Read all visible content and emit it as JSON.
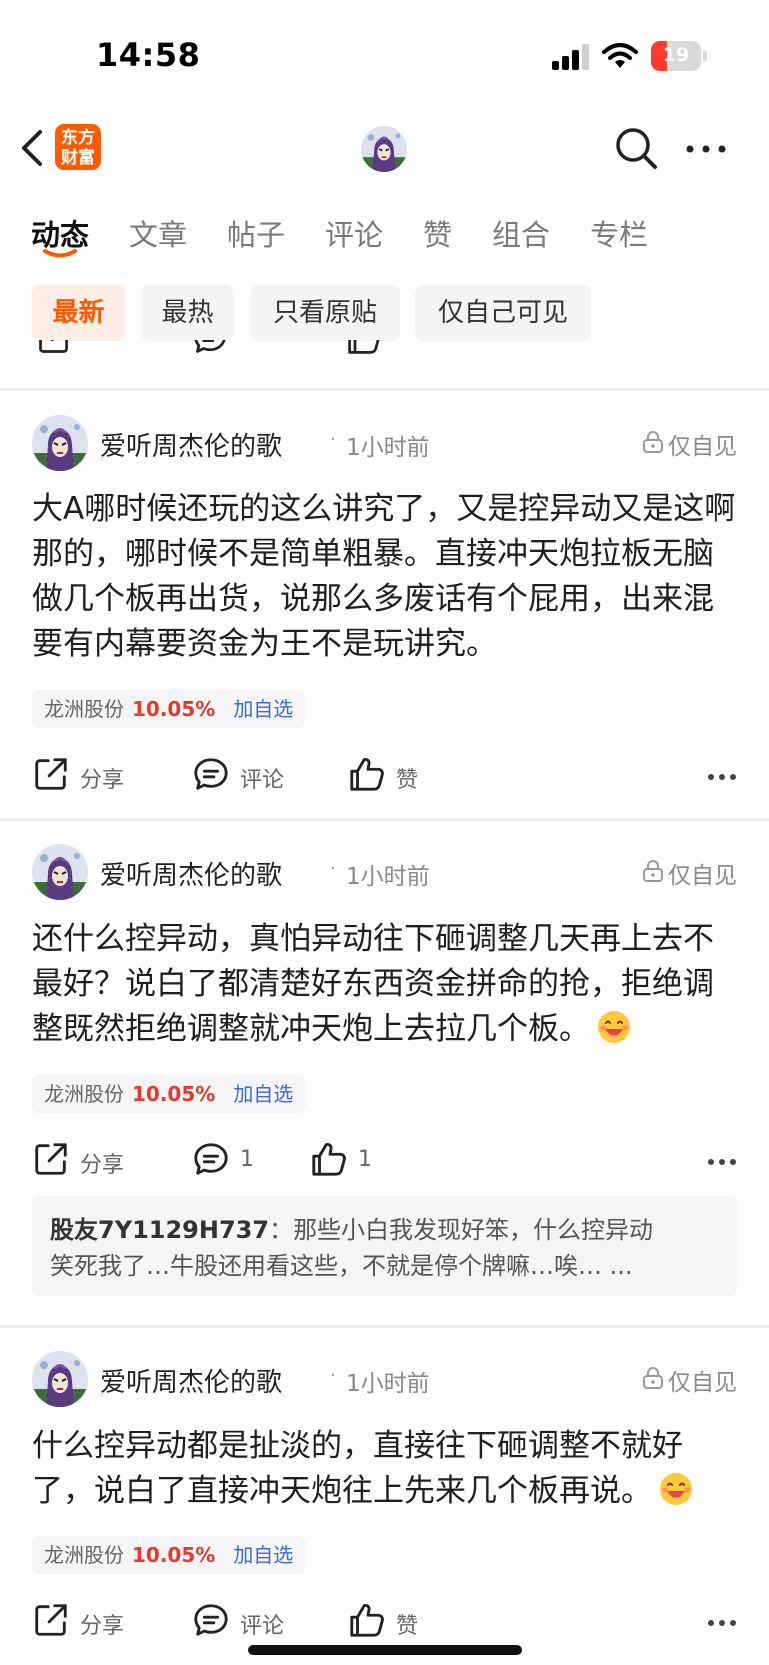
{
  "status_bar": {
    "time": "14:58",
    "battery": "19"
  },
  "header": {
    "logo_text_line1": "东方",
    "logo_text_line2": "财富"
  },
  "tabs": [
    {
      "label": "动态",
      "active": true
    },
    {
      "label": "文章"
    },
    {
      "label": "帖子"
    },
    {
      "label": "评论"
    },
    {
      "label": "赞"
    },
    {
      "label": "组合"
    },
    {
      "label": "专栏"
    }
  ],
  "filters": [
    {
      "label": "最新",
      "active": true
    },
    {
      "label": "最热"
    },
    {
      "label": "只看原贴"
    },
    {
      "label": "仅自己可见"
    }
  ],
  "colors": {
    "accent": "#ff5a00",
    "stock_up": "#e23b2e",
    "link_blue": "#3c6bd6"
  },
  "posts": [
    {
      "author": "爱听周杰伦的歌",
      "sep": "·",
      "time": "1小时前",
      "privacy": "仅自见",
      "body": "大A哪时候还玩的这么讲究了，又是控异动又是这啊那的，哪时候不是简单粗暴。直接冲天炮拉板无脑做几个板再出货，说那么多废话有个屁用，出来混要有内幕要资金为王不是玩讲究。",
      "stock": {
        "name": "龙洲股份",
        "change": "10.05%",
        "add": "加自选"
      },
      "actions": {
        "share": "分享",
        "comment": "评论",
        "like": "赞"
      }
    },
    {
      "author": "爱听周杰伦的歌",
      "sep": "·",
      "time": "1小时前",
      "privacy": "仅自见",
      "body": "还什么控异动，真怕异动往下砸调整几天再上去不最好？说白了都清楚好东西资金拼命的抢，拒绝调整既然拒绝调整就冲天炮上去拉几个板。",
      "stock": {
        "name": "龙洲股份",
        "change": "10.05%",
        "add": "加自选"
      },
      "actions": {
        "share": "分享",
        "comment": "1",
        "like": "1"
      },
      "reply": {
        "user": "股友7Y1129H737",
        "colon": "：",
        "line1": "那些小白我发现好笨，什么控异动",
        "line2": "笑死我了…牛股还用看这些，不就是停个牌嘛…唉…",
        "more": "..."
      }
    },
    {
      "author": "爱听周杰伦的歌",
      "sep": "·",
      "time": "1小时前",
      "privacy": "仅自见",
      "body": "什么控异动都是扯淡的，直接往下砸调整不就好了，说白了直接冲天炮往上先来几个板再说。",
      "stock": {
        "name": "龙洲股份",
        "change": "10.05%",
        "add": "加自选"
      },
      "actions": {
        "share": "分享",
        "comment": "评论",
        "like": "赞"
      }
    }
  ]
}
